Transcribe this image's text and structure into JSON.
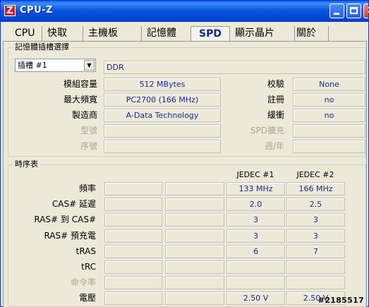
{
  "app": {
    "icon_letter": "Z",
    "title": "CPU-Z"
  },
  "window_controls": {
    "minimize": "minimize-icon",
    "maximize": "maximize-icon",
    "close_glyph": "✕"
  },
  "tabs": [
    {
      "label": "CPU",
      "active": false
    },
    {
      "label": "快取",
      "active": false
    },
    {
      "label": "主機板",
      "active": false
    },
    {
      "label": "記憶體",
      "active": false
    },
    {
      "label": "SPD",
      "active": true
    },
    {
      "label": "顯示晶片",
      "active": false
    },
    {
      "label": "關於",
      "active": false
    }
  ],
  "slot_group": {
    "title": "記憶體插槽選擇",
    "slot_select": "插槽 #1",
    "memory_type": "DDR",
    "rows": [
      {
        "label": "模組容量",
        "value": "512 MBytes",
        "right_label": "校驗",
        "right_value": "None",
        "dim": false
      },
      {
        "label": "最大頻寬",
        "value": "PC2700 (166 MHz)",
        "right_label": "註冊",
        "right_value": "no",
        "dim": false
      },
      {
        "label": "製造商",
        "value": "A-Data Technology",
        "right_label": "緩衝",
        "right_value": "no",
        "dim": false
      },
      {
        "label": "型號",
        "value": "",
        "right_label": "SPD擴充",
        "right_value": "",
        "dim": true
      },
      {
        "label": "序號",
        "value": "",
        "right_label": "週/年",
        "right_value": "",
        "dim": true
      }
    ]
  },
  "timing_group": {
    "title": "時序表",
    "columns": [
      "",
      "",
      "JEDEC #1",
      "JEDEC #2"
    ],
    "rows": [
      {
        "label": "頻率",
        "values": [
          "",
          "",
          "133 MHz",
          "166 MHz"
        ],
        "dim": false
      },
      {
        "label": "CAS# 延遲",
        "values": [
          "",
          "",
          "2.0",
          "2.5"
        ],
        "dim": false
      },
      {
        "label": "RAS# 到 CAS#",
        "values": [
          "",
          "",
          "3",
          "3"
        ],
        "dim": false
      },
      {
        "label": "RAS# 預充電",
        "values": [
          "",
          "",
          "3",
          "3"
        ],
        "dim": false
      },
      {
        "label": "tRAS",
        "values": [
          "",
          "",
          "6",
          "7"
        ],
        "dim": false
      },
      {
        "label": "tRC",
        "values": [
          "",
          "",
          "",
          ""
        ],
        "dim": false
      },
      {
        "label": "命令率",
        "values": [
          "",
          "",
          "",
          ""
        ],
        "dim": true
      },
      {
        "label": "電壓",
        "values": [
          "",
          "",
          "2.50 V",
          "2.50 V"
        ],
        "dim": false
      }
    ]
  },
  "watermark": "#2185517"
}
